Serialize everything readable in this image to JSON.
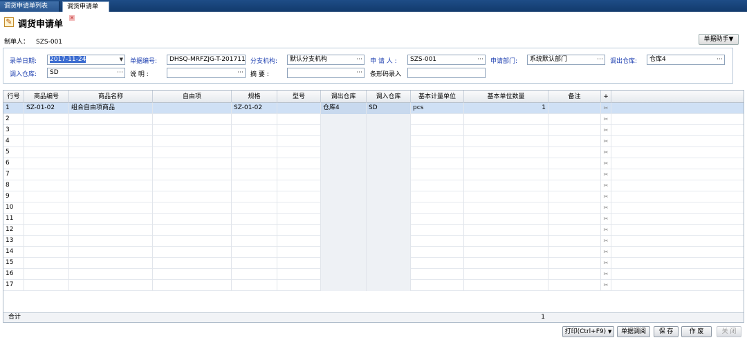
{
  "tabs": [
    {
      "label": "调货申请单列表"
    },
    {
      "label": "调货申请单"
    }
  ],
  "page": {
    "title": "调货申请单",
    "maker_label": "制单人：",
    "maker_value": "SZS-001",
    "helper_button": "单据助手▼"
  },
  "form": {
    "date_label": "录单日期:",
    "date_value": "2017-11-24",
    "docno_label": "单据编号:",
    "docno_value": "DHSQ-MRFZJG-T-201711",
    "branch_label": "分支机构:",
    "branch_value": "默认分支机构",
    "applicant_label": "申 请 人 :",
    "applicant_value": "SZS-001",
    "dept_label": "申请部门:",
    "dept_value": "系统默认部门",
    "out_wh_label": "调出仓库:",
    "out_wh_value": "仓库4",
    "in_wh_label": "调入仓库:",
    "in_wh_value": "SD",
    "desc_label": "说 明 :",
    "desc_value": "",
    "summary_label": "摘 要 :",
    "summary_value": "",
    "barcode_label": "条形码录入",
    "barcode_value": ""
  },
  "grid": {
    "headers": [
      "行号",
      "商品编号",
      "商品名称",
      "自由项",
      "规格",
      "型号",
      "调出仓库",
      "调入仓库",
      "基本计量单位",
      "基本单位数量",
      "备注",
      "+"
    ],
    "rows": [
      {
        "no": "1",
        "code": "SZ-01-02",
        "name": "组合自由项商品",
        "free": "",
        "spec": "SZ-01-02",
        "model": "",
        "out_wh": "仓库4",
        "in_wh": "SD",
        "unit": "pcs",
        "qty": "1",
        "note": ""
      },
      {
        "no": "2"
      },
      {
        "no": "3"
      },
      {
        "no": "4"
      },
      {
        "no": "5"
      },
      {
        "no": "6"
      },
      {
        "no": "7"
      },
      {
        "no": "8"
      },
      {
        "no": "9"
      },
      {
        "no": "10"
      },
      {
        "no": "11"
      },
      {
        "no": "12"
      },
      {
        "no": "13"
      },
      {
        "no": "14"
      },
      {
        "no": "15"
      },
      {
        "no": "16"
      },
      {
        "no": "17"
      }
    ],
    "footer_label": "合计",
    "footer_qty": "1"
  },
  "buttons": {
    "print": "打印(Ctrl+F9)",
    "query": "单据调阅",
    "save": "保 存",
    "void": "作 废",
    "close": "关 闭"
  }
}
